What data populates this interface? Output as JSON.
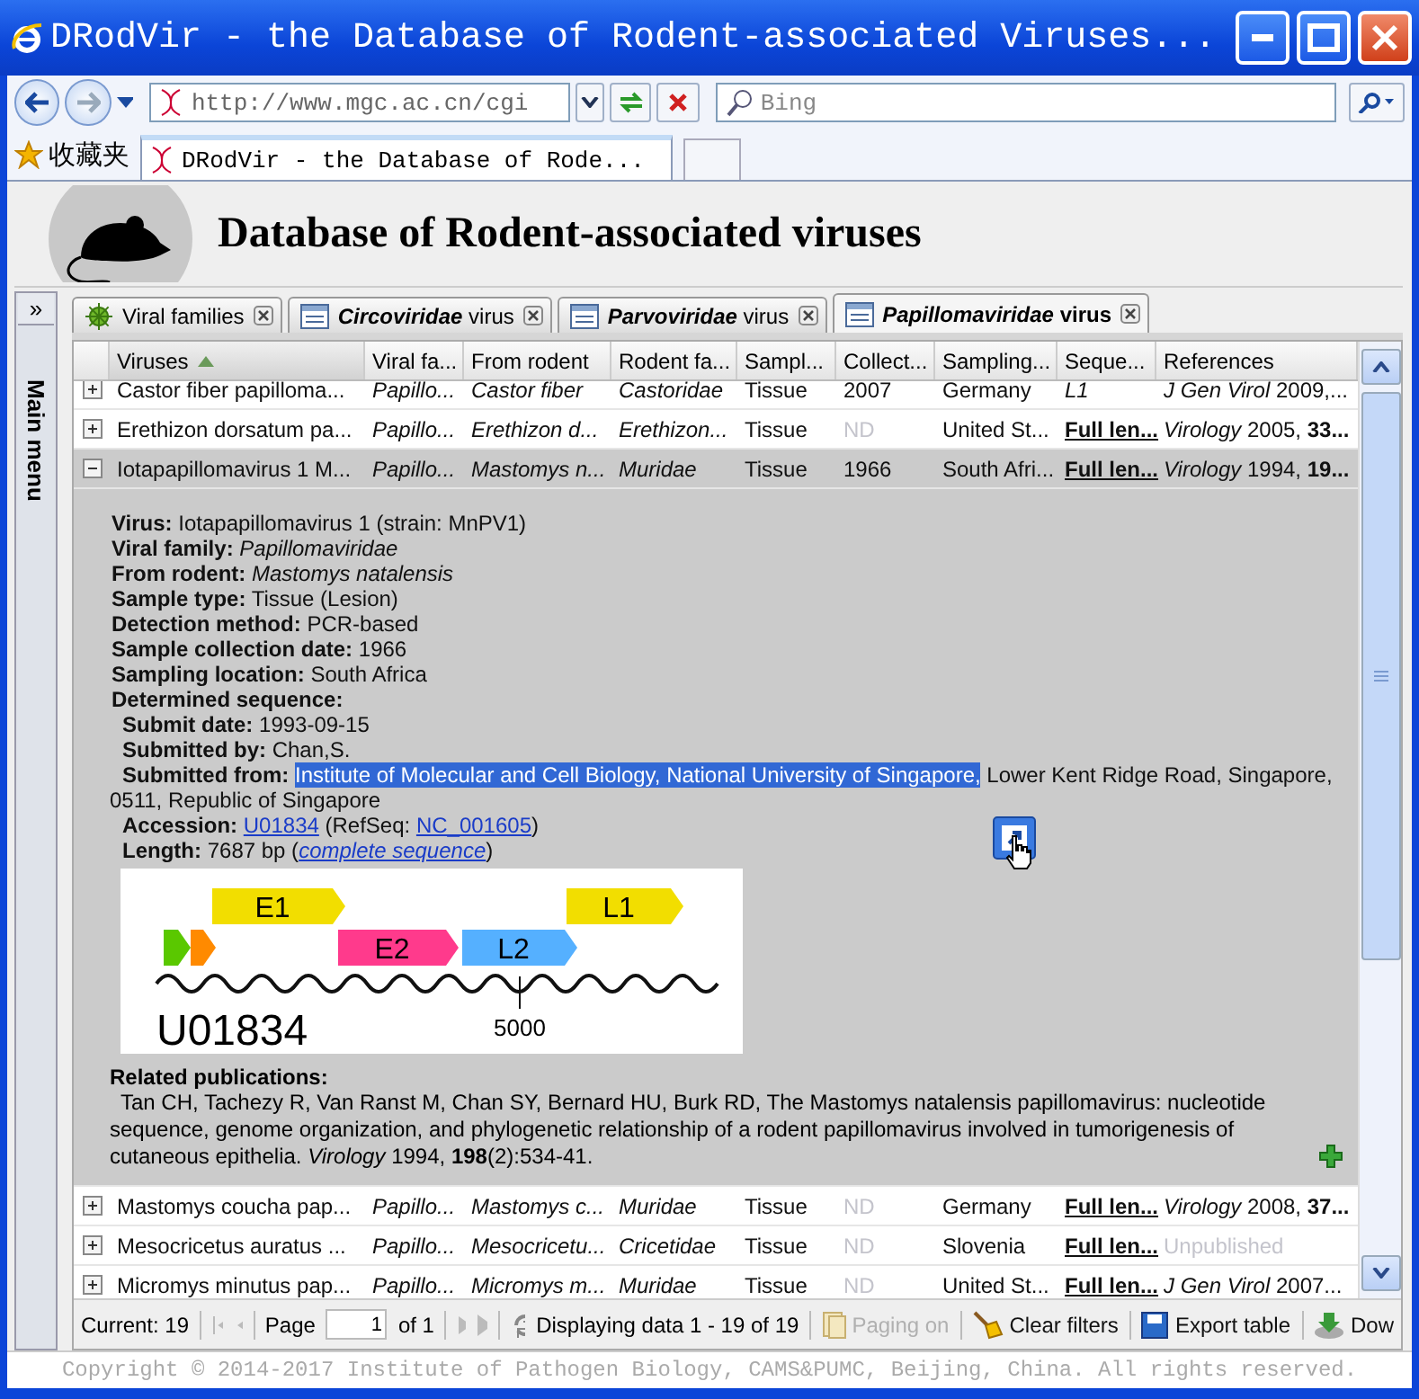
{
  "window": {
    "title": "DRodVir - the Database of Rodent-associated Viruses..."
  },
  "address_bar": {
    "url": "http://www.mgc.ac.cn/cgi",
    "search_placeholder": "Bing"
  },
  "favorites": {
    "label": "收藏夹"
  },
  "browser_tabs": [
    {
      "title": "DRodVir - the Database of Rode...",
      "selected": true
    }
  ],
  "site": {
    "title": "Database of Rodent-associated viruses"
  },
  "side_menu": {
    "label": "Main menu",
    "toggle": "»"
  },
  "tabs": [
    {
      "label": "Viral families",
      "selected": false,
      "kind": "virus"
    },
    {
      "emphasis": "Circoviridae",
      "label": "virus",
      "selected": false,
      "kind": "table"
    },
    {
      "emphasis": "Parvoviridae",
      "label": "virus",
      "selected": false,
      "kind": "table"
    },
    {
      "emphasis": "Papillomaviridae",
      "label": "virus",
      "selected": true,
      "kind": "table"
    }
  ],
  "table": {
    "columns": [
      {
        "label": "Viruses",
        "italic": false,
        "sorted": true
      },
      {
        "label": "Viral fa...",
        "italic": true,
        "sorted": false
      },
      {
        "label": "From rodent",
        "italic": true,
        "sorted": false
      },
      {
        "label": "Rodent fa...",
        "italic": true,
        "sorted": false
      },
      {
        "label": "Sampl...",
        "italic": false,
        "sorted": false
      },
      {
        "label": "Collect...",
        "italic": false,
        "sorted": false
      },
      {
        "label": "Sampling...",
        "italic": false,
        "sorted": false
      },
      {
        "label": "Seque...",
        "italic": false,
        "sorted": false
      },
      {
        "label": "References",
        "italic": false,
        "sorted": false
      }
    ],
    "rows": [
      {
        "expanded": false,
        "selected": false,
        "cells": [
          "Castor fiber papilloma...",
          "Papillo...",
          "Castor fiber",
          "Castoridae",
          "Tissue",
          "2007",
          "Germany",
          {
            "text": "L1",
            "kind": "italic"
          },
          "*J Gen Virol* 2009,..."
        ]
      },
      {
        "expanded": false,
        "selected": false,
        "cells": [
          "Erethizon dorsatum pa...",
          "Papillo...",
          "Erethizon d...",
          "Erethizon...",
          "Tissue",
          {
            "text": "ND",
            "kind": "muted"
          },
          "United St...",
          {
            "text": "Full len...",
            "kind": "link"
          },
          "*Virology* 2005, **33...**"
        ]
      },
      {
        "expanded": true,
        "selected": true,
        "cells": [
          "Iotapapillomavirus 1 M...",
          "Papillo...",
          "Mastomys n...",
          "Muridae",
          "Tissue",
          "1966",
          "South Afri...",
          {
            "text": "Full len...",
            "kind": "link"
          },
          "*Virology* 1994, **19...**"
        ]
      },
      {
        "expanded": false,
        "selected": false,
        "cells": [
          "Mastomys coucha pap...",
          "Papillo...",
          "Mastomys c...",
          "Muridae",
          "Tissue",
          {
            "text": "ND",
            "kind": "muted"
          },
          "Germany",
          {
            "text": "Full len...",
            "kind": "link"
          },
          "*Virology* 2008, **37...**"
        ]
      },
      {
        "expanded": false,
        "selected": false,
        "cells": [
          "Mesocricetus auratus ...",
          "Papillo...",
          "Mesocricetu...",
          "Cricetidae",
          "Tissue",
          {
            "text": "ND",
            "kind": "muted"
          },
          "Slovenia",
          {
            "text": "Full len...",
            "kind": "link"
          },
          {
            "text": "Unpublished",
            "kind": "muted"
          }
        ]
      },
      {
        "expanded": false,
        "selected": false,
        "cells": [
          "Micromys minutus pap...",
          "Papillo...",
          "Micromys m...",
          "Muridae",
          "Tissue",
          {
            "text": "ND",
            "kind": "muted"
          },
          "United St...",
          {
            "text": "Full len...",
            "kind": "link"
          },
          "*J Gen Virol* 2007..."
        ]
      }
    ]
  },
  "detail": {
    "lines": [
      {
        "label": "Virus:",
        "parts": [
          {
            "kind": "text",
            "text": "Iotapapillomavirus 1 (strain: MnPV1)"
          }
        ]
      },
      {
        "label": "Viral family:",
        "parts": [
          {
            "kind": "italic",
            "text": "Papillomaviridae"
          }
        ]
      },
      {
        "label": "From rodent:",
        "parts": [
          {
            "kind": "italic",
            "text": "Mastomys natalensis"
          }
        ]
      },
      {
        "label": "Sample type:",
        "parts": [
          {
            "kind": "text",
            "text": "Tissue (Lesion)"
          }
        ]
      },
      {
        "label": "Detection method:",
        "parts": [
          {
            "kind": "text",
            "text": "PCR-based"
          }
        ]
      },
      {
        "label": "Sample collection date:",
        "parts": [
          {
            "kind": "text",
            "text": "1966"
          }
        ]
      },
      {
        "label": "Sampling location:",
        "parts": [
          {
            "kind": "text",
            "text": "South Africa"
          }
        ]
      },
      {
        "label": "Determined sequence:",
        "children": [
          {
            "label": "Submit date:",
            "parts": [
              {
                "kind": "text",
                "text": "1993-09-15"
              }
            ]
          },
          {
            "label": "Submitted by:",
            "parts": [
              {
                "kind": "text",
                "text": "Chan,S."
              }
            ]
          },
          {
            "label": "Submitted from:",
            "parts": [
              {
                "kind": "highlight",
                "text": "Institute of Molecular and Cell Biology, National University of Singapore,"
              },
              {
                "kind": "text",
                "text": " Lower Kent Ridge Road, Singapore, 0511, Republic of Singapore"
              }
            ]
          },
          {
            "label": "Accession:",
            "parts": [
              {
                "kind": "link",
                "text": "U01834"
              },
              {
                "kind": "text",
                "text": " (RefSeq: "
              },
              {
                "kind": "link",
                "text": "NC_001605"
              },
              {
                "kind": "text",
                "text": ")"
              }
            ]
          },
          {
            "label": "Length:",
            "parts": [
              {
                "kind": "text",
                "text": "7687 bp ("
              },
              {
                "kind": "italic-link",
                "text": "complete sequence"
              },
              {
                "kind": "text",
                "text": ")"
              }
            ]
          }
        ]
      }
    ],
    "genome_map": {
      "accession": "U01834",
      "tick": "5000",
      "genes": [
        {
          "color": "#5ac800"
        },
        {
          "color": "#ff8a00"
        },
        {
          "label": "E1",
          "color": "#f2de00"
        },
        {
          "label": "E2",
          "color": "#ff3a8c"
        },
        {
          "label": "L2",
          "color": "#55b0ff"
        },
        {
          "label": "L1",
          "color": "#f2de00"
        }
      ]
    },
    "publications": {
      "heading": "Related publications:",
      "items": [
        "Tan CH, Tachezy R, Van Ranst M, Chan SY, Bernard HU, Burk RD, The Mastomys natalensis papillomavirus: nucleotide sequence, genome organization, and phylogenetic relationship of a rodent papillomavirus involved in tumorigenesis of cutaneous epithelia. *Virology* 1994, **198**(2):534-41."
      ]
    }
  },
  "paging": {
    "current": "Current: 19",
    "page_label": "Page",
    "page_value": "1",
    "page_of": "of 1",
    "display": "Displaying data 1 - 19 of 19",
    "buttons": [
      {
        "label": "Paging on",
        "disabled": true
      },
      {
        "label": "Clear filters",
        "disabled": false
      },
      {
        "label": "Export table",
        "disabled": false
      },
      {
        "label": "Dow",
        "disabled": false
      }
    ]
  },
  "footer": {
    "copyright": "Copyright © 2014-2017 Institute of Pathogen Biology, CAMS&PUMC, Beijing, China. All rights reserved."
  }
}
